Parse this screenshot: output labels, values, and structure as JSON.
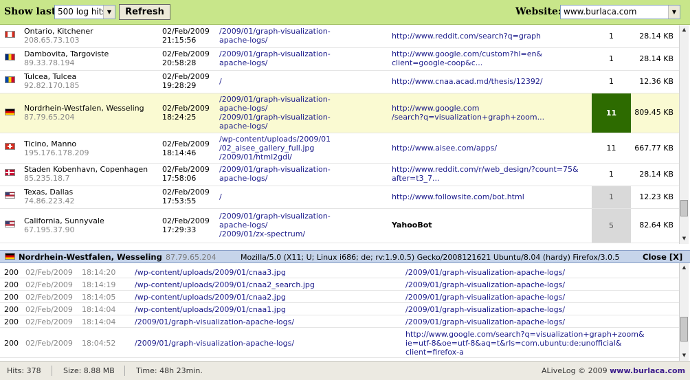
{
  "toolbar": {
    "show_last_label": "Show last:",
    "show_last_value": "500 log hits",
    "refresh_label": "Refresh",
    "website_label": "Website:",
    "website_value": "www.burlaca.com"
  },
  "colors": {
    "toolbar_bg": "#c8e68a",
    "highlight_row": "#fafad2",
    "hits_big": "#2d6b00",
    "detail_bar": "#c6d4ea",
    "link": "#1a1a8a"
  },
  "log_rows": [
    {
      "flag": "canada-flag-icon",
      "location": "Ontario, Kitchener",
      "ip": "208.65.73.103",
      "date": "02/Feb/2009",
      "time": "21:15:56",
      "pages": [
        "/2009/01/graph-visualization-",
        "apache-logs/"
      ],
      "referrer": [
        "http://www.reddit.com/search?q=graph"
      ],
      "hits": "1",
      "size": "28.14 KB"
    },
    {
      "flag": "romania-flag-icon",
      "location": "Dambovita, Targoviste",
      "ip": "89.33.78.194",
      "date": "02/Feb/2009",
      "time": "20:58:28",
      "pages": [
        "/2009/01/graph-visualization-",
        "apache-logs/"
      ],
      "referrer": [
        "http://www.google.com/custom?hl=en&",
        "client=google-coop&c..."
      ],
      "hits": "1",
      "size": "28.14 KB"
    },
    {
      "flag": "moldova-flag-icon",
      "location": "Tulcea, Tulcea",
      "ip": "92.82.170.185",
      "date": "02/Feb/2009",
      "time": "19:28:29",
      "pages": [
        "/"
      ],
      "referrer": [
        "http://www.cnaa.acad.md/thesis/12392/"
      ],
      "hits": "1",
      "size": "12.36 KB"
    },
    {
      "flag": "germany-flag-icon",
      "location": "Nordrhein-Westfalen, Wesseling",
      "ip": "87.79.65.204",
      "date": "02/Feb/2009",
      "time": "18:24:25",
      "pages": [
        "/2009/01/graph-visualization-",
        "apache-logs/",
        "/2009/01/graph-visualization-",
        "apache-logs/"
      ],
      "referrer": [
        "http://www.google.com",
        "/search?q=visualization+graph+zoom..."
      ],
      "hits": "11",
      "size": "809.45 KB"
    },
    {
      "flag": "switzerland-flag-icon",
      "location": "Ticino, Manno",
      "ip": "195.176.178.209",
      "date": "02/Feb/2009",
      "time": "18:14:46",
      "pages": [
        "/wp-content/uploads/2009/01",
        "/02_aisee_gallery_full.jpg",
        "/2009/01/html2gdl/"
      ],
      "referrer": [
        "http://www.aisee.com/apps/"
      ],
      "hits": "11",
      "size": "667.77 KB"
    },
    {
      "flag": "denmark-flag-icon",
      "location": "Staden Kobenhavn, Copenhagen",
      "ip": "85.235.18.7",
      "date": "02/Feb/2009",
      "time": "17:58:06",
      "pages": [
        "/2009/01/graph-visualization-",
        "apache-logs/"
      ],
      "referrer": [
        "http://www.reddit.com/r/web_design/?count=75&",
        "after=t3_7..."
      ],
      "hits": "1",
      "size": "28.14 KB"
    },
    {
      "flag": "usa-flag-icon",
      "location": "Texas, Dallas",
      "ip": "74.86.223.42",
      "date": "02/Feb/2009",
      "time": "17:53:55",
      "pages": [
        "/"
      ],
      "referrer": [
        "http://www.followsite.com/bot.html"
      ],
      "hits": "1",
      "size": "12.23 KB"
    },
    {
      "flag": "usa-flag-icon",
      "location": "California, Sunnyvale",
      "ip": "67.195.37.90",
      "date": "02/Feb/2009",
      "time": "17:29:33",
      "pages": [
        "/2009/01/graph-visualization-",
        "apache-logs/",
        "/2009/01/zx-spectrum/"
      ],
      "referrer": [
        "YahooBot"
      ],
      "hits": "5",
      "size": "82.64 KB"
    }
  ],
  "detail": {
    "location": "Nordrhein-Westfalen, Wesseling",
    "ip": "87.79.65.204",
    "user_agent": "Mozilla/5.0 (X11; U; Linux i686; de; rv:1.9.0.5) Gecko/2008121621 Ubuntu/8.04 (hardy) Firefox/3.0.5",
    "close_label": "Close [X]"
  },
  "detail_rows": [
    {
      "code": "200",
      "date": "02/Feb/2009",
      "time": "18:14:20",
      "page": "/wp-content/uploads/2009/01/cnaa3.jpg",
      "referrer": [
        "/2009/01/graph-visualization-apache-logs/"
      ]
    },
    {
      "code": "200",
      "date": "02/Feb/2009",
      "time": "18:14:19",
      "page": "/wp-content/uploads/2009/01/cnaa2_search.jpg",
      "referrer": [
        "/2009/01/graph-visualization-apache-logs/"
      ]
    },
    {
      "code": "200",
      "date": "02/Feb/2009",
      "time": "18:14:05",
      "page": "/wp-content/uploads/2009/01/cnaa2.jpg",
      "referrer": [
        "/2009/01/graph-visualization-apache-logs/"
      ]
    },
    {
      "code": "200",
      "date": "02/Feb/2009",
      "time": "18:14:04",
      "page": "/wp-content/uploads/2009/01/cnaa1.jpg",
      "referrer": [
        "/2009/01/graph-visualization-apache-logs/"
      ]
    },
    {
      "code": "200",
      "date": "02/Feb/2009",
      "time": "18:14:04",
      "page": "/2009/01/graph-visualization-apache-logs/",
      "referrer": [
        "/2009/01/graph-visualization-apache-logs/"
      ]
    },
    {
      "code": "200",
      "date": "02/Feb/2009",
      "time": "18:04:52",
      "page": "/2009/01/graph-visualization-apache-logs/",
      "referrer": [
        "http://www.google.com/search?q=visualization+graph+zoom&",
        "ie=utf-8&oe=utf-8&aq=t&rls=com.ubuntu:de:unofficial&",
        "client=firefox-a"
      ]
    }
  ],
  "status": {
    "hits": "Hits: 378",
    "size": "Size: 8.88 MB",
    "time": "Time: 48h 23min.",
    "brand_prefix": "ALiveLog © 2009",
    "brand_site": "www.burlaca.com"
  }
}
